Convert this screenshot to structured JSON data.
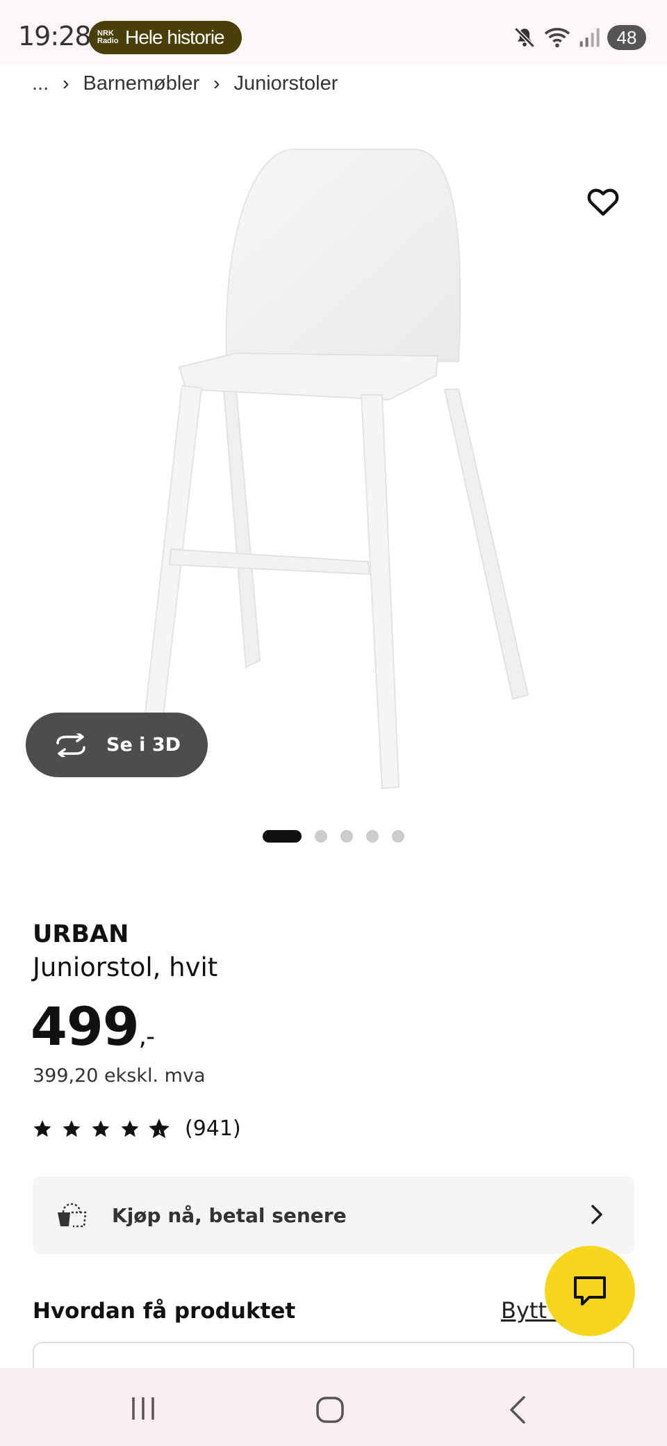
{
  "status_bar": {
    "time": "19:28",
    "nrk_line1": "NRK",
    "nrk_line2": "Radio",
    "pill_text": "Hele historie",
    "battery": "48"
  },
  "breadcrumb": {
    "ellipsis": "...",
    "items": [
      "Barnemøbler",
      "Juniorstoler"
    ]
  },
  "gallery": {
    "view_3d_label": "Se i 3D",
    "image_count": 5,
    "active_index": 0
  },
  "product": {
    "name": "URBAN",
    "description": "Juniorstol, hvit",
    "price": "499",
    "price_suffix": ",-",
    "price_ex_vat": "399,20 ekskl. mva",
    "rating_stars": 4.5,
    "rating_count": "(941)"
  },
  "buy_now": {
    "label": "Kjøp nå, betal senere"
  },
  "delivery": {
    "title": "Hvordan få produktet",
    "link": "Bytt butikk"
  },
  "colors": {
    "accent_yellow": "#f6d61d",
    "dark_button": "#4d4d4d",
    "status_pill": "#4a3f06"
  },
  "icons": [
    "heart-icon",
    "rotate-3d-icon",
    "star-icon",
    "installment-icon",
    "chevron-right-icon",
    "chat-icon",
    "recent-apps-icon",
    "home-icon",
    "back-icon",
    "mute-icon",
    "wifi-icon",
    "signal-icon"
  ]
}
